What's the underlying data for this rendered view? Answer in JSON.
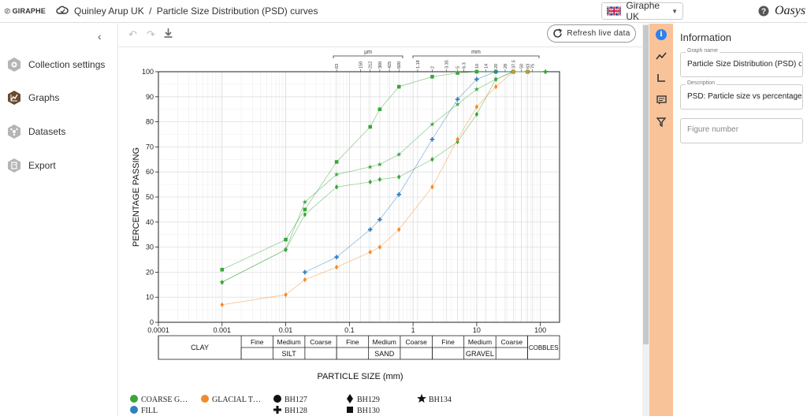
{
  "app": {
    "logo_text": "GIRAPHE",
    "org": "Quinley Arup UK",
    "crumb_sep": "/",
    "page": "Particle Size Distribution (PSD) curves"
  },
  "language": {
    "label": "Giraphe UK"
  },
  "brand": {
    "oasys": "Oasys"
  },
  "sidebar": {
    "items": [
      {
        "label": "Collection settings",
        "icon": "gear-hex-icon"
      },
      {
        "label": "Graphs",
        "icon": "graph-icon"
      },
      {
        "label": "Datasets",
        "icon": "dataset-icon"
      },
      {
        "label": "Export",
        "icon": "export-icon"
      }
    ]
  },
  "toolbar": {
    "refresh_label": "Refresh live data"
  },
  "panel": {
    "title": "Information",
    "graph_name_label": "Graph name",
    "graph_name_value": "Particle Size Distribution (PSD) cu",
    "description_label": "Description",
    "description_value": "PSD: Particle size vs percentage p",
    "figure_placeholder": "Figure number"
  },
  "colors": {
    "green": "#3aa53a",
    "orange": "#f28c28",
    "blue": "#2f7fc1",
    "accent": "#f9c39a"
  },
  "chart_data": {
    "type": "scatter",
    "xlabel": "PARTICLE SIZE (mm)",
    "ylabel": "PERCENTAGE PASSING",
    "xscale": "log",
    "xlim": [
      0.0001,
      200
    ],
    "ylim": [
      0,
      100
    ],
    "x_ticks": [
      "0.0001",
      "0.001",
      "0.01",
      "0.1",
      "1",
      "10",
      "100"
    ],
    "y_ticks": [
      0,
      10,
      20,
      30,
      40,
      50,
      60,
      70,
      80,
      90,
      100
    ],
    "top_axis": {
      "um_label": "µm",
      "mm_label": "mm",
      "um_sieves": [
        {
          "label": "63",
          "x": 0.063
        },
        {
          "label": "150",
          "x": 0.15
        },
        {
          "label": "212",
          "x": 0.212
        },
        {
          "label": "300",
          "x": 0.3
        },
        {
          "label": "425",
          "x": 0.425
        },
        {
          "label": "600",
          "x": 0.6
        }
      ],
      "mm_sieves": [
        {
          "label": "1.18",
          "x": 1.18
        },
        {
          "label": "2",
          "x": 2
        },
        {
          "label": "3.35",
          "x": 3.35
        },
        {
          "label": "5",
          "x": 5
        },
        {
          "label": "6.3",
          "x": 6.3
        },
        {
          "label": "10",
          "x": 10
        },
        {
          "label": "14",
          "x": 14
        },
        {
          "label": "20",
          "x": 20
        },
        {
          "label": "28",
          "x": 28
        },
        {
          "label": "37.5",
          "x": 37.5
        },
        {
          "label": "50",
          "x": 50
        },
        {
          "label": "63",
          "x": 63
        },
        {
          "label": "75",
          "x": 75
        }
      ]
    },
    "classification": {
      "top": [
        {
          "label": "",
          "from": 0.0001,
          "to": 0.002
        },
        {
          "label": "Fine",
          "from": 0.002,
          "to": 0.0063
        },
        {
          "label": "Medium",
          "from": 0.0063,
          "to": 0.02
        },
        {
          "label": "Coarse",
          "from": 0.02,
          "to": 0.063
        },
        {
          "label": "Fine",
          "from": 0.063,
          "to": 0.2
        },
        {
          "label": "Medium",
          "from": 0.2,
          "to": 0.63
        },
        {
          "label": "Coarse",
          "from": 0.63,
          "to": 2
        },
        {
          "label": "Fine",
          "from": 2,
          "to": 6.3
        },
        {
          "label": "Medium",
          "from": 6.3,
          "to": 20
        },
        {
          "label": "Coarse",
          "from": 20,
          "to": 63
        },
        {
          "label": "",
          "from": 63,
          "to": 200
        }
      ],
      "bottom": [
        {
          "label": "CLAY",
          "from": 0.0001,
          "to": 0.002,
          "span": true
        },
        {
          "label": "SILT",
          "from": 0.002,
          "to": 0.063
        },
        {
          "label": "SAND",
          "from": 0.063,
          "to": 2
        },
        {
          "label": "GRAVEL",
          "from": 2,
          "to": 63
        },
        {
          "label": "COBBLES",
          "from": 63,
          "to": 200,
          "span": true
        }
      ]
    },
    "series": [
      {
        "name": "COARSE G…",
        "color": "#3aa53a",
        "marker": "square",
        "points": [
          [
            0.001,
            21
          ],
          [
            0.01,
            33
          ],
          [
            0.02,
            45
          ],
          [
            0.063,
            64
          ],
          [
            0.212,
            78
          ],
          [
            0.3,
            85
          ],
          [
            0.6,
            94
          ],
          [
            2,
            98
          ],
          [
            5,
            99.5
          ],
          [
            10,
            100
          ],
          [
            20,
            100
          ],
          [
            37.5,
            100
          ],
          [
            63,
            100
          ]
        ]
      },
      {
        "name": "COARSE G…",
        "color": "#3aa53a",
        "marker": "star",
        "points": [
          [
            0.001,
            16
          ],
          [
            0.01,
            29
          ],
          [
            0.02,
            48
          ],
          [
            0.063,
            59
          ],
          [
            0.212,
            62
          ],
          [
            0.3,
            63
          ],
          [
            0.6,
            67
          ],
          [
            2,
            79
          ],
          [
            5,
            87
          ],
          [
            10,
            93
          ],
          [
            20,
            97
          ],
          [
            37.5,
            100
          ],
          [
            120,
            100
          ]
        ]
      },
      {
        "name": "COARSE G…",
        "color": "#3aa53a",
        "marker": "diamond",
        "points": [
          [
            0.001,
            16
          ],
          [
            0.01,
            29
          ],
          [
            0.02,
            43
          ],
          [
            0.063,
            54
          ],
          [
            0.212,
            56
          ],
          [
            0.3,
            57
          ],
          [
            0.6,
            58
          ],
          [
            2,
            65
          ],
          [
            5,
            72
          ],
          [
            10,
            83
          ],
          [
            20,
            97
          ],
          [
            37.5,
            100
          ],
          [
            120,
            100
          ]
        ]
      },
      {
        "name": "FILL",
        "color": "#2f7fc1",
        "marker": "plus",
        "points": [
          [
            0.02,
            20
          ],
          [
            0.063,
            26
          ],
          [
            0.212,
            37
          ],
          [
            0.3,
            41
          ],
          [
            0.6,
            51
          ],
          [
            2,
            73
          ],
          [
            5,
            89
          ],
          [
            10,
            97
          ],
          [
            20,
            100
          ],
          [
            37.5,
            100
          ],
          [
            63,
            100
          ]
        ]
      },
      {
        "name": "GLACIAL T…",
        "color": "#f28c28",
        "marker": "diamond",
        "points": [
          [
            0.001,
            7
          ],
          [
            0.01,
            11
          ],
          [
            0.02,
            17
          ],
          [
            0.063,
            22
          ],
          [
            0.212,
            28
          ],
          [
            0.3,
            30
          ],
          [
            0.6,
            37
          ],
          [
            2,
            54
          ],
          [
            5,
            73
          ],
          [
            10,
            86
          ],
          [
            20,
            94
          ],
          [
            37.5,
            100
          ],
          [
            63,
            100
          ]
        ]
      }
    ],
    "legend": [
      {
        "label": "COARSE G…",
        "swatch": "circle",
        "color": "#3aa53a"
      },
      {
        "label": "GLACIAL T…",
        "swatch": "circle",
        "color": "#f28c28"
      },
      {
        "label": "BH127",
        "swatch": "circle",
        "color": "#111"
      },
      {
        "label": "BH129",
        "swatch": "diamond",
        "color": "#111"
      },
      {
        "label": "BH134",
        "swatch": "star",
        "color": "#111"
      },
      {
        "label": "FILL",
        "swatch": "circle",
        "color": "#2f7fc1"
      },
      {
        "label": "BH128",
        "swatch": "plus",
        "color": "#111"
      },
      {
        "label": "BH130",
        "swatch": "square",
        "color": "#111"
      }
    ]
  }
}
